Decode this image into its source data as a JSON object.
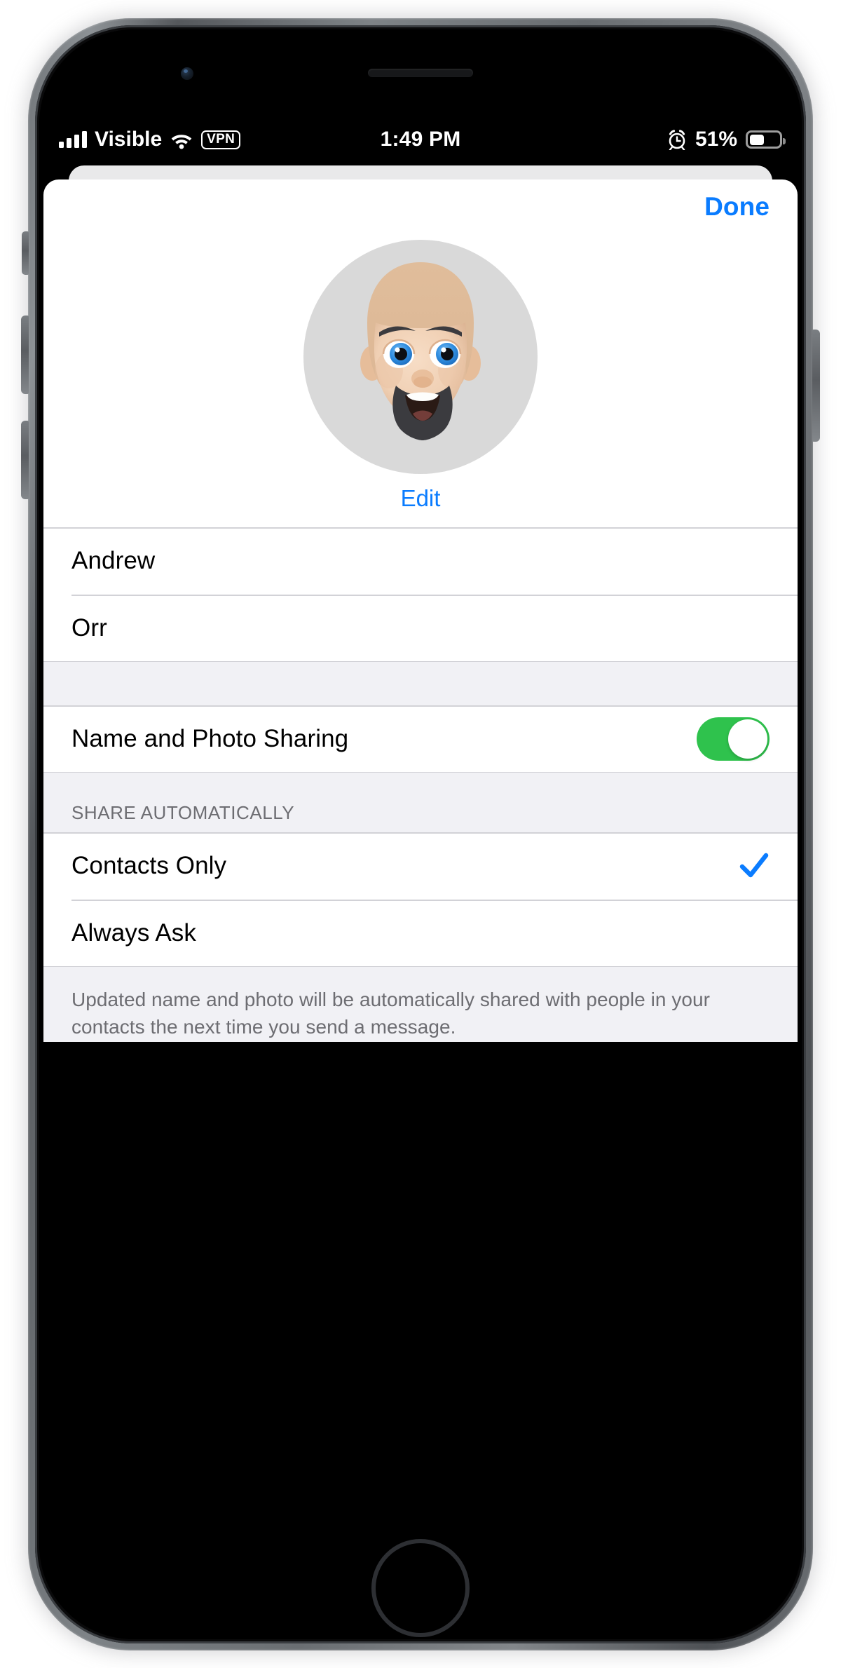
{
  "status_bar": {
    "carrier": "Visible",
    "vpn_label": "VPN",
    "time": "1:49 PM",
    "battery_percent": "51%",
    "battery_level": 51,
    "signal_bars": 4,
    "icons": [
      "cellular-signal-icon",
      "wifi-icon",
      "vpn-badge-icon",
      "alarm-clock-icon",
      "battery-icon"
    ]
  },
  "sheet": {
    "done_label": "Done",
    "edit_label": "Edit",
    "avatar_alt": "memoji-avatar",
    "name_fields": [
      {
        "name": "first-name-field",
        "value": "Andrew",
        "placeholder": "First Name"
      },
      {
        "name": "last-name-field",
        "value": "Orr",
        "placeholder": "Last Name"
      }
    ],
    "sharing_toggle": {
      "label": "Name and Photo Sharing",
      "state": "on"
    },
    "share_section": {
      "header": "SHARE AUTOMATICALLY",
      "options": [
        {
          "label": "Contacts Only",
          "selected": true
        },
        {
          "label": "Always Ask",
          "selected": false
        }
      ],
      "footer": "Updated name and photo will be automatically shared with people in your contacts the next time you send a message."
    }
  },
  "colors": {
    "ios_blue": "#0a7cff",
    "toggle_green": "#2fc24d",
    "group_background": "#f1f1f5",
    "separator": "#d2d2d7",
    "secondary_text": "#6d6d72",
    "avatar_background": "#d9d9d9"
  }
}
